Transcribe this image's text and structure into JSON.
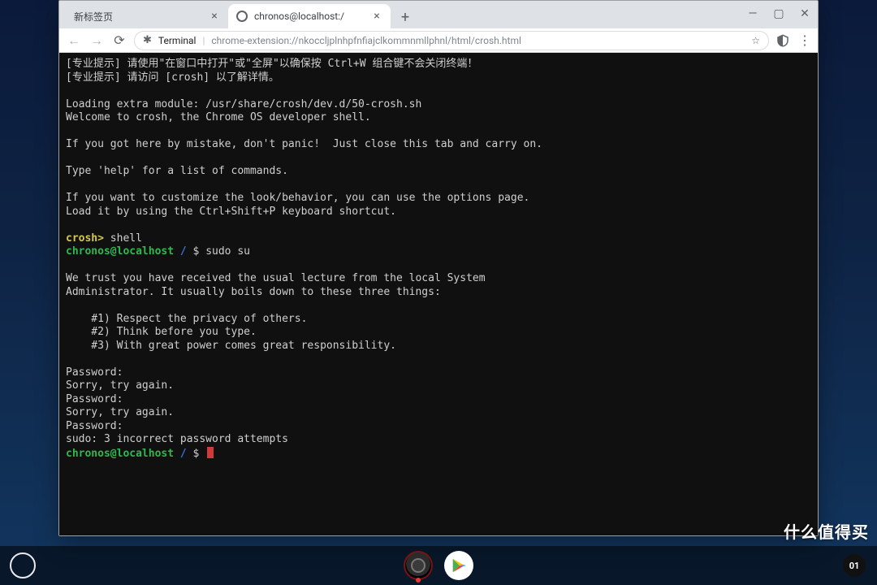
{
  "tabs": {
    "items": [
      {
        "title": "新标签页",
        "active": false
      },
      {
        "title": "chronos@localhost:/",
        "active": true
      }
    ]
  },
  "window_controls": {
    "minimize": "—",
    "maximize": "▢",
    "close": "✕"
  },
  "toolbar": {
    "app_chip": "Terminal",
    "url": "chrome-extension://nkoccljplnhpfnfiajclkommnmllphnl/html/crosh.html"
  },
  "terminal": {
    "tip1": "[专业提示] 请使用\"在窗口中打开\"或\"全屏\"以确保按 Ctrl+W 组合键不会关闭终端！",
    "tip2": "[专业提示] 请访问 [crosh] 以了解详情。",
    "loading": "Loading extra module: /usr/share/crosh/dev.d/50-crosh.sh",
    "welcome": "Welcome to crosh, the Chrome OS developer shell.",
    "mistake": "If you got here by mistake, don't panic!  Just close this tab and carry on.",
    "help": "Type 'help' for a list of commands.",
    "customize1": "If you want to customize the look/behavior, you can use the options page.",
    "customize2": "Load it by using the Ctrl+Shift+P keyboard shortcut.",
    "crosh_prompt": "crosh>",
    "crosh_cmd": " shell",
    "ps1_user": "chronos@localhost",
    "ps1_path": " / ",
    "ps1_dollar": "$ ",
    "cmd_sudo": "sudo su",
    "lecture1": "We trust you have received the usual lecture from the local System",
    "lecture2": "Administrator. It usually boils down to these three things:",
    "rule1": "    #1) Respect the privacy of others.",
    "rule2": "    #2) Think before you type.",
    "rule3": "    #3) With great power comes great responsibility.",
    "pw": "Password: ",
    "sorry": "Sorry, try again.",
    "fail": "sudo: 3 incorrect password attempts"
  },
  "status": {
    "time": "01"
  },
  "watermark": "什么值得买"
}
